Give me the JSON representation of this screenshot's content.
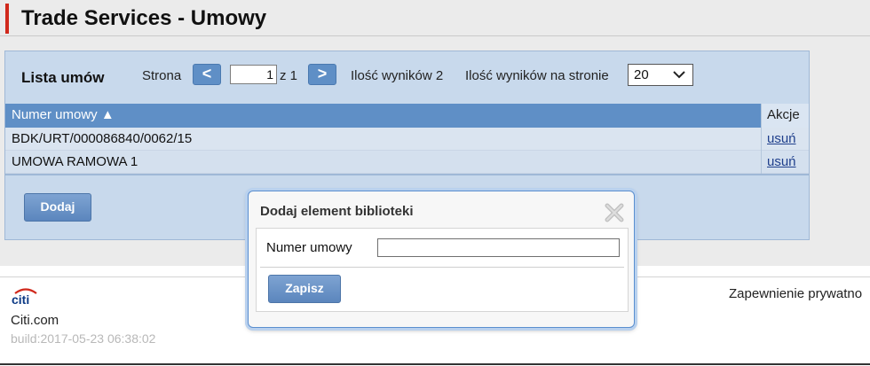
{
  "header": {
    "title": "Trade Services - Umowy"
  },
  "list": {
    "title": "Lista umów",
    "pager": {
      "page_label": "Strona",
      "prev_symbol": "<",
      "next_symbol": ">",
      "current_page": "1",
      "of_label": "z 1",
      "results_label": "Ilość wyników 2",
      "per_page_label": "Ilość wyników na stronie",
      "per_page_value": "20"
    },
    "columns": {
      "number": "Numer umowy ▲",
      "actions": "Akcje"
    },
    "rows": [
      {
        "number": "BDK/URT/000086840/0062/15",
        "action": "usuń"
      },
      {
        "number": "UMOWA RAMOWA 1",
        "action": "usuń"
      }
    ],
    "add_button": "Dodaj"
  },
  "dialog": {
    "title": "Dodaj element biblioteki",
    "field_label": "Numer umowy",
    "field_value": "",
    "save_button": "Zapisz"
  },
  "footer": {
    "logo_text": "citi",
    "site": "Citi.com",
    "build": "build:2017-05-23 06:38:02",
    "privacy": "Zapewnienie prywatno"
  },
  "colors": {
    "accent_red": "#d0291c",
    "header_blue": "#5f8fc6",
    "panel_bg": "#c8d9ec",
    "link": "#1f3f8c"
  },
  "icons": {
    "close": "close-icon",
    "dropdown": "chevron-down-icon",
    "logo": "citi-logo-icon"
  }
}
